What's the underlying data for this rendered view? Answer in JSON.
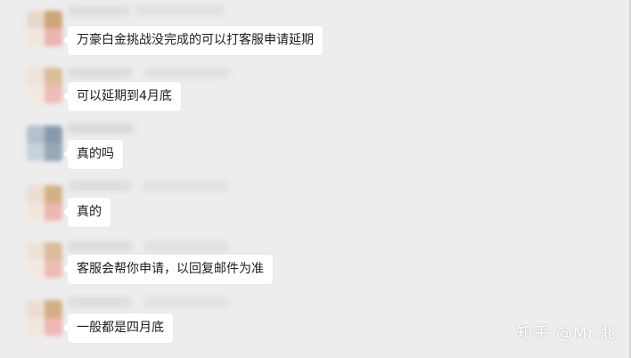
{
  "messages": [
    {
      "text": "万豪白金挑战没完成的可以打客服申请延期"
    },
    {
      "text": "可以延期到4月底"
    },
    {
      "text": "真的吗"
    },
    {
      "text": "真的"
    },
    {
      "text": "客服会帮你申请，以回复邮件为准"
    },
    {
      "text": "一般都是四月底"
    }
  ],
  "watermark": {
    "text": "知乎 @Mr.北"
  },
  "colors": {
    "background": "#ededed",
    "bubble": "#ffffff",
    "text": "#1c1c1c",
    "avatar_tan": "#d6b894",
    "avatar_pink": "#efb6b0",
    "avatar_blue": "#8a9eb0"
  }
}
